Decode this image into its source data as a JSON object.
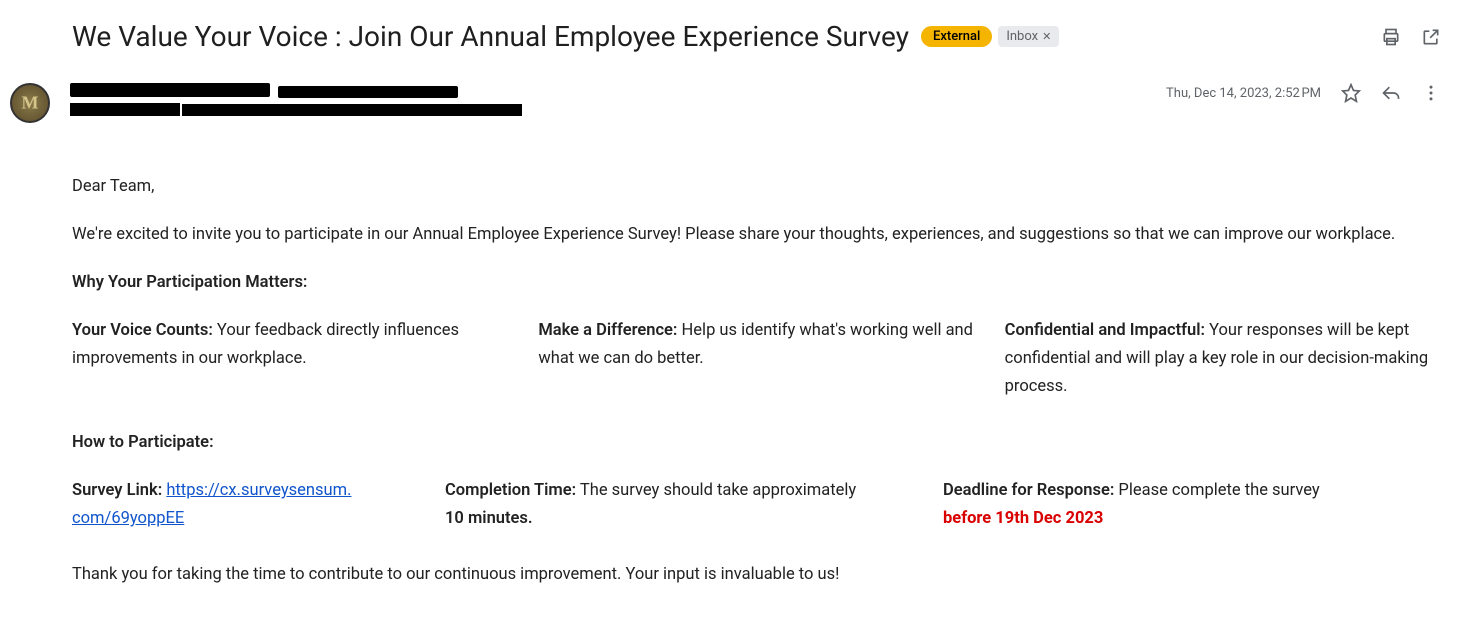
{
  "header": {
    "subject": "We Value Your Voice : Join Our Annual Employee Experience Survey",
    "external_label": "External",
    "inbox_label": "Inbox"
  },
  "meta": {
    "timestamp": "Thu, Dec 14, 2023, 2:52 PM"
  },
  "body": {
    "greeting": "Dear Team,",
    "intro": "We're excited to invite you to participate in our Annual Employee Experience Survey! Please share your thoughts, experiences, and suggestions so that we can improve our workplace.",
    "why_heading": "Why Your Participation Matters:",
    "why_cols": [
      {
        "title": "Your Voice Counts:",
        "text": " Your feedback directly influences improvements in our workplace."
      },
      {
        "title": "Make a Difference:",
        "text": " Help us identify what's working well and what we can do better."
      },
      {
        "title": "Confidential and Impactful:",
        "text": " Your responses will be  kept confidential and will play a key role in our decision-making process."
      }
    ],
    "how_heading": "How to Participate:",
    "how_cols": {
      "survey": {
        "title": "Survey Link:",
        "link_text_a": "https://cx.surveysensum.",
        "link_text_b": "com/69yoppEE"
      },
      "time": {
        "title": "Completion Time:",
        "text": " The survey should take approximately ",
        "strong_tail": "10 minutes."
      },
      "deadline": {
        "title": "Deadline for Response:",
        "text": " Please complete the survey ",
        "red": "before 19th Dec 2023"
      }
    },
    "thanks": "Thank you for taking the time to contribute to our continuous improvement. Your input is invaluable to us!"
  }
}
